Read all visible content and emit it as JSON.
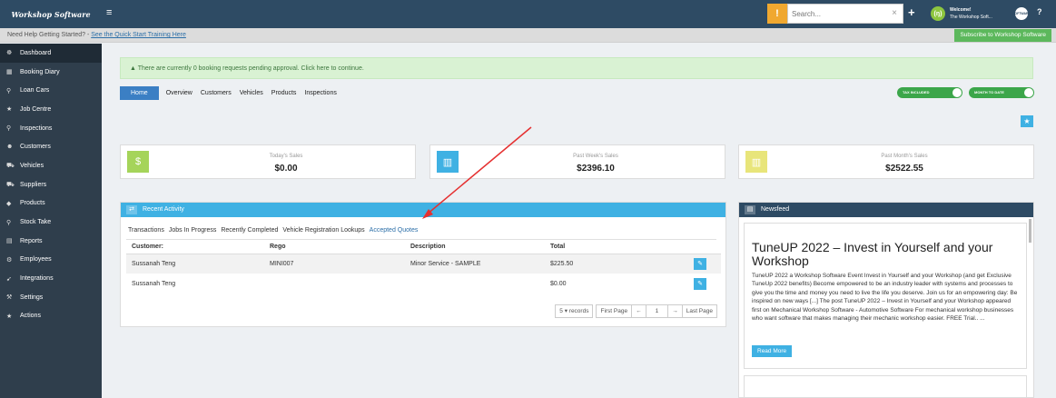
{
  "brand": "Workshop Software",
  "topbar": {
    "search_placeholder": "Search...",
    "welcome_line1": "Welcome!",
    "welcome_line2": "The Workshop Soft...",
    "user_logo": "(ŋ)",
    "avatar_text": "SOFTWARE"
  },
  "helpbar": {
    "prefix": "Need Help Getting Started? - ",
    "link": "See the Quick Start Training Here",
    "subscribe": "Subscribe to Workshop Software"
  },
  "sidebar": {
    "items": [
      {
        "label": "Dashboard",
        "icon": "dashboard-icon",
        "glyph": "☸"
      },
      {
        "label": "Booking Diary",
        "icon": "calendar-icon",
        "glyph": "▦"
      },
      {
        "label": "Loan Cars",
        "icon": "search-icon",
        "glyph": "⚲"
      },
      {
        "label": "Job Centre",
        "icon": "star-icon",
        "glyph": "★"
      },
      {
        "label": "Inspections",
        "icon": "search-icon",
        "glyph": "⚲"
      },
      {
        "label": "Customers",
        "icon": "users-icon",
        "glyph": "☻"
      },
      {
        "label": "Vehicles",
        "icon": "car-icon",
        "glyph": "⛟"
      },
      {
        "label": "Suppliers",
        "icon": "truck-icon",
        "glyph": "⛟"
      },
      {
        "label": "Products",
        "icon": "tag-icon",
        "glyph": "◆"
      },
      {
        "label": "Stock Take",
        "icon": "search-icon",
        "glyph": "⚲"
      },
      {
        "label": "Reports",
        "icon": "chart-icon",
        "glyph": "▤"
      },
      {
        "label": "Employees",
        "icon": "gears-icon",
        "glyph": "⚙"
      },
      {
        "label": "Integrations",
        "icon": "rocket-icon",
        "glyph": "➹"
      },
      {
        "label": "Settings",
        "icon": "wrench-icon",
        "glyph": "⚒"
      },
      {
        "label": "Actions",
        "icon": "star-icon",
        "glyph": "★"
      }
    ]
  },
  "alert": "There are currently 0 booking requests pending approval. Click here to continue.",
  "nav_tabs": [
    "Home",
    "Overview",
    "Customers",
    "Vehicles",
    "Products",
    "Inspections"
  ],
  "toggles": {
    "tax": "TAX INCLUDED",
    "month": "MONTH TO DATE"
  },
  "stats": [
    {
      "label": "Today's Sales",
      "value": "$0.00",
      "color": "#a5d45a",
      "glyph": "$"
    },
    {
      "label": "Past Week's Sales",
      "value": "$2396.10",
      "color": "#3fb1e3",
      "glyph": "▥"
    },
    {
      "label": "Past Month's Sales",
      "value": "$2522.55",
      "color": "#e8e57a",
      "glyph": "▥"
    }
  ],
  "recent_activity": {
    "title": "Recent Activity",
    "tabs": [
      "Transactions",
      "Jobs In Progress",
      "Recently Completed",
      "Vehicle Registration Lookups",
      "Accepted Quotes"
    ],
    "columns": [
      "Customer:",
      "Rego",
      "Description",
      "Total"
    ],
    "rows": [
      {
        "customer": "Sussanah Teng",
        "rego": "MINI007",
        "description": "Minor Service - SAMPLE",
        "total": "$225.50"
      },
      {
        "customer": "Sussanah Teng",
        "rego": "",
        "description": "",
        "total": "$0.00"
      }
    ],
    "pager": {
      "records": "5",
      "records_label": "records",
      "first": "First Page",
      "prev": "←",
      "page": "1",
      "next": "→",
      "last": "Last Page"
    }
  },
  "newsfeed": {
    "title": "Newsfeed",
    "headline": "TuneUP 2022 – Invest in Yourself and your Workshop",
    "body": "TuneUP 2022 a Workshop Software Event Invest in Yourself and your Workshop (and get Exclusive TuneUp 2022 benefits) Become empowered to be an industry leader with systems and processes to give you the time and money you need to live the life you deserve. Join us for an empowering day: Be inspired on new ways [...] The post TuneUP 2022 – Invest in Yourself and your Workshop appeared first on Mechanical Workshop Software - Automotive Software For mechanical workshop businesses who want software that makes managing their mechanic workshop easier. FREE Trial.. ...",
    "read_more": "Read More"
  },
  "colors": {
    "topbar": "#2e4b64",
    "sidebar": "#2f3e4c",
    "accent": "#3fb1e3",
    "primary": "#3b7fc4",
    "success": "#5cb85c",
    "annotation_arrow": "#e53030"
  }
}
